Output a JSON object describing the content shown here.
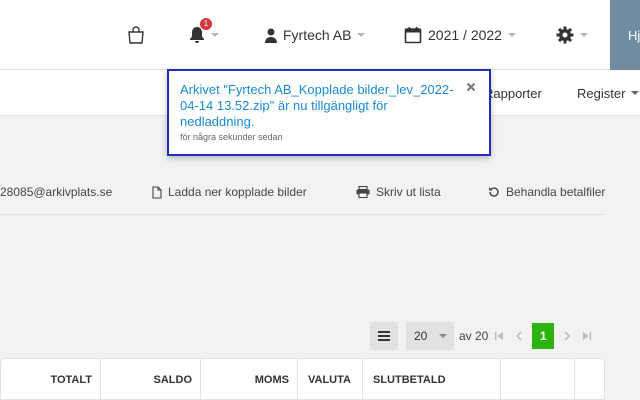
{
  "topbar": {
    "notification_count": "1",
    "company": "Fyrtech AB",
    "fiscal_year": "2021 / 2022",
    "help_label": "Hj"
  },
  "menu": {
    "rapporter": "Rapporter",
    "register": "Register"
  },
  "actions": {
    "email": "28085@arkivplats.se",
    "download_images": "Ladda ner kopplade bilder",
    "print_list": "Skriv ut lista",
    "bank_files": "Behandla betalfiler"
  },
  "pagination": {
    "page_size": "20",
    "of_text": "av 20",
    "current_page": "1"
  },
  "table": {
    "columns": [
      "TOTALT",
      "SALDO",
      "MOMS",
      "VALUTA",
      "SLUTBETALD",
      "",
      ""
    ]
  },
  "notification": {
    "message": "Arkivet \"Fyrtech AB_Kopplade bilder_lev_2022-04-14 13.52.zip\" är nu tillgängligt för nedladdning.",
    "time": "för några sekunder sedan"
  },
  "colors": {
    "accent_blue": "#1a8ad4",
    "notification_border": "#1f2fbf",
    "pager_active": "#2bb30e",
    "badge_red": "#d9363e",
    "help_bg": "#6f8ca3"
  },
  "icons": [
    "shopping-bag-icon",
    "bell-icon",
    "user-icon",
    "calendar-icon",
    "gear-icon",
    "file-icon",
    "printer-icon",
    "undo-icon",
    "list-icon",
    "close-icon"
  ]
}
